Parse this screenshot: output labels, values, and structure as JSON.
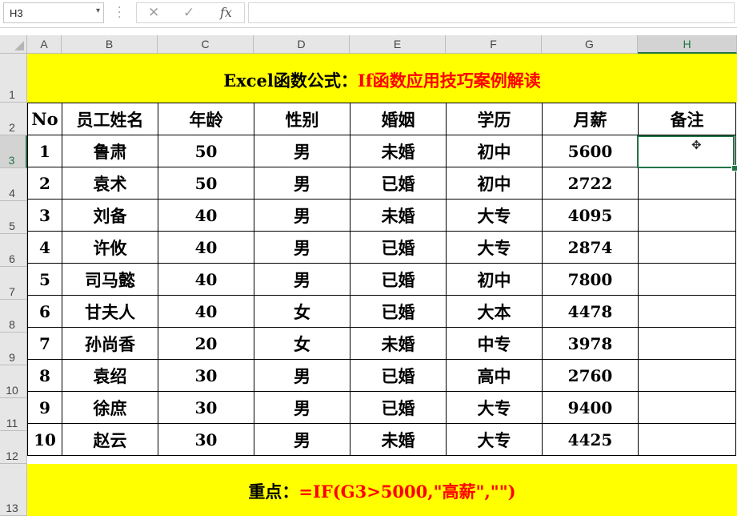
{
  "formula_bar": {
    "name_box": "H3",
    "cancel_icon": "✕",
    "enter_icon": "✓",
    "fx_label": "fx",
    "formula": ""
  },
  "columns": [
    "A",
    "B",
    "C",
    "D",
    "E",
    "F",
    "G",
    "H"
  ],
  "rows": [
    "1",
    "2",
    "3",
    "4",
    "5",
    "6",
    "7",
    "8",
    "9",
    "10",
    "11",
    "12",
    "13"
  ],
  "title": {
    "part1": "Excel函数公式：",
    "part2": "If函数应用技巧案例解读"
  },
  "table": {
    "headers": [
      "No",
      "员工姓名",
      "年龄",
      "性别",
      "婚姻",
      "学历",
      "月薪",
      "备注"
    ],
    "rows": [
      [
        "1",
        "鲁肃",
        "50",
        "男",
        "未婚",
        "初中",
        "5600",
        ""
      ],
      [
        "2",
        "袁术",
        "50",
        "男",
        "已婚",
        "初中",
        "2722",
        ""
      ],
      [
        "3",
        "刘备",
        "40",
        "男",
        "未婚",
        "大专",
        "4095",
        ""
      ],
      [
        "4",
        "许攸",
        "40",
        "男",
        "已婚",
        "大专",
        "2874",
        ""
      ],
      [
        "5",
        "司马懿",
        "40",
        "男",
        "已婚",
        "初中",
        "7800",
        ""
      ],
      [
        "6",
        "甘夫人",
        "40",
        "女",
        "已婚",
        "大本",
        "4478",
        ""
      ],
      [
        "7",
        "孙尚香",
        "20",
        "女",
        "未婚",
        "中专",
        "3978",
        ""
      ],
      [
        "8",
        "袁绍",
        "30",
        "男",
        "已婚",
        "高中",
        "2760",
        ""
      ],
      [
        "9",
        "徐庶",
        "30",
        "男",
        "已婚",
        "大专",
        "9400",
        ""
      ],
      [
        "10",
        "赵云",
        "30",
        "男",
        "未婚",
        "大专",
        "4425",
        ""
      ]
    ]
  },
  "note": {
    "label": "重点：",
    "formula": "=IF(G3>5000,\"高薪\",\"\")"
  },
  "colors": {
    "banner_bg": "#ffff00",
    "highlight_red": "#ff0000",
    "selection_green": "#217346"
  }
}
